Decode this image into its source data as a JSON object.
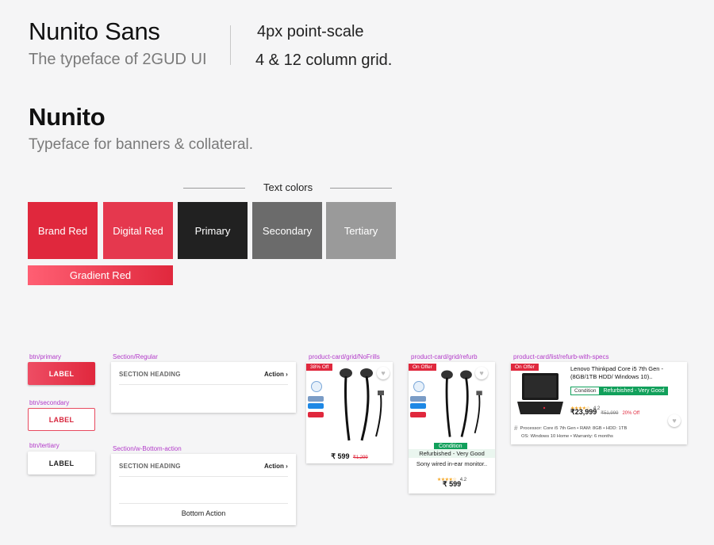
{
  "header": {
    "font_title": "Nunito Sans",
    "font_subtitle": "The typeface of 2GUD UI",
    "scale": "4px point-scale",
    "grid": "4 & 12 column grid.",
    "font2_title": "Nunito",
    "font2_subtitle": "Typeface for banners & collateral."
  },
  "colors": {
    "section_title": "Text colors",
    "swatches": [
      {
        "label": "Brand Red",
        "color": "#e0283d"
      },
      {
        "label": "Digital Red",
        "color": "#e5384e"
      },
      {
        "label": "Primary",
        "color": "#212121"
      },
      {
        "label": "Secondary",
        "color": "#6b6b6b"
      },
      {
        "label": "Tertiary",
        "color": "#9a9a9a"
      }
    ],
    "gradient_label": "Gradient Red",
    "gradient_from": "#ff5f73",
    "gradient_to": "#e0283d"
  },
  "buttons": {
    "primary_tag": "btn/primary",
    "primary_label": "LABEL",
    "secondary_tag": "btn/secondary",
    "secondary_label": "LABEL",
    "tertiary_tag": "btn/tertiary",
    "tertiary_label": "LABEL"
  },
  "sections": {
    "regular_tag": "Section/Regular",
    "regular_heading": "SECTION HEADING",
    "regular_action": "Action ›",
    "bottom_tag": "Section/w-Bottom-action",
    "bottom_heading": "SECTION HEADING",
    "bottom_action": "Action ›",
    "bottom_button": "Bottom Action"
  },
  "product_nofrills": {
    "tag": "product-card/grid/NoFrills",
    "discount": "38% Off",
    "price": "₹ 599",
    "mrp": "₹1,299"
  },
  "product_refurb": {
    "tag": "product-card/grid/refurb",
    "discount": "On Offer",
    "condition_tag": "Condition",
    "condition": "Refurbished - Very Good",
    "title": "Sony wired in-ear monitor..",
    "rating": "4.2",
    "price": "₹ 599"
  },
  "product_list": {
    "tag": "product-card/list/refurb-with-specs",
    "discount": "On Offer",
    "title": "Lenovo Thinkpad Core i5 7th Gen - (8GB/1TB HDD/ Windows 10)..",
    "condition_tag": "Condition",
    "condition": "Refurbished - Very Good",
    "rating": "4.2",
    "price": "₹23,999",
    "mrp": "₹51,999",
    "off": "20% Off",
    "specs_line1": "Processor: Core i5 7th Gen   •  RAM: 8GB  •  HDD: 1TB",
    "specs_line2": "OS: Windows 10 Home  •  Warranty: 6 months"
  }
}
